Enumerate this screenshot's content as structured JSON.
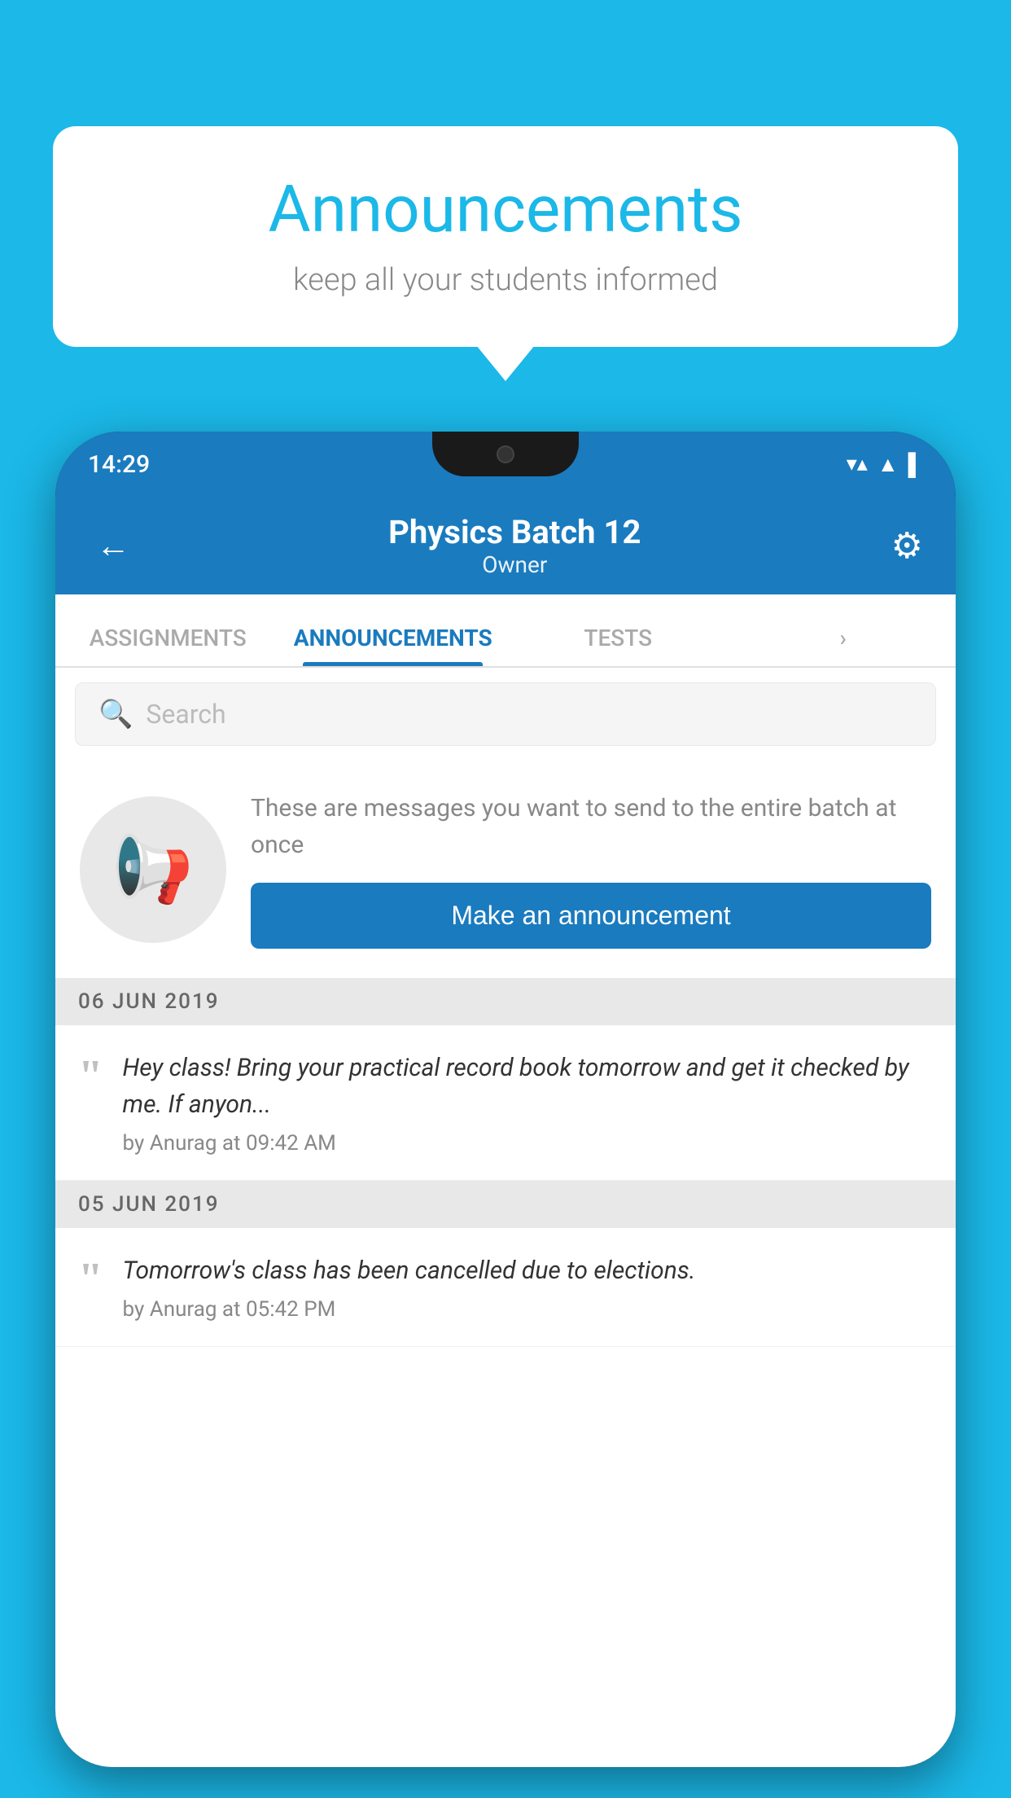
{
  "bubble": {
    "title": "Announcements",
    "subtitle": "keep all your students informed"
  },
  "phone": {
    "status": {
      "time": "14:29",
      "icons": [
        "▾▴▪",
        "▲",
        "▌"
      ]
    },
    "header": {
      "title": "Physics Batch 12",
      "subtitle": "Owner",
      "back_icon": "←",
      "settings_icon": "⚙"
    },
    "tabs": [
      {
        "label": "ASSIGNMENTS",
        "active": false
      },
      {
        "label": "ANNOUNCEMENTS",
        "active": true
      },
      {
        "label": "TESTS",
        "active": false
      },
      {
        "label": "",
        "active": false
      }
    ],
    "search": {
      "placeholder": "Search"
    },
    "prompt": {
      "description": "These are messages you want to send to the entire batch at once",
      "button_label": "Make an announcement"
    },
    "announcements": [
      {
        "date": "06  JUN  2019",
        "text": "Hey class! Bring your practical record book tomorrow and get it checked by me. If anyon...",
        "meta": "by Anurag at 09:42 AM"
      },
      {
        "date": "05  JUN  2019",
        "text": "Tomorrow's class has been cancelled due to elections.",
        "meta": "by Anurag at 05:42 PM"
      }
    ]
  },
  "colors": {
    "primary": "#1bb8e8",
    "app_blue": "#1a7bbf",
    "white": "#ffffff",
    "text_dark": "#333333",
    "text_muted": "#888888"
  }
}
